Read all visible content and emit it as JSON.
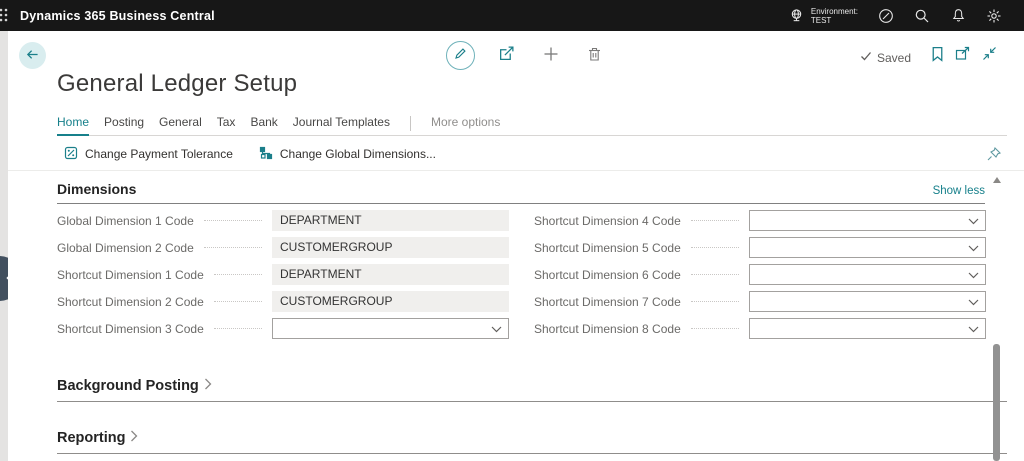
{
  "topbar": {
    "title": "Dynamics 365 Business Central",
    "environment_label": "Environment:",
    "environment_name": "TEST"
  },
  "toolbar": {
    "saved_label": "Saved"
  },
  "page": {
    "title": "General Ledger Setup"
  },
  "tabs": [
    {
      "label": "Home",
      "active": true
    },
    {
      "label": "Posting",
      "active": false
    },
    {
      "label": "General",
      "active": false
    },
    {
      "label": "Tax",
      "active": false
    },
    {
      "label": "Bank",
      "active": false
    },
    {
      "label": "Journal Templates",
      "active": false
    }
  ],
  "more_options_label": "More options",
  "actions": [
    {
      "label": "Change Payment Tolerance"
    },
    {
      "label": "Change Global Dimensions..."
    }
  ],
  "dimensions_section": {
    "title": "Dimensions",
    "show_less_label": "Show less",
    "left_fields": [
      {
        "label": "Global Dimension 1 Code",
        "value": "DEPARTMENT",
        "type": "readonly"
      },
      {
        "label": "Global Dimension 2 Code",
        "value": "CUSTOMERGROUP",
        "type": "readonly"
      },
      {
        "label": "Shortcut Dimension 1 Code",
        "value": "DEPARTMENT",
        "type": "readonly"
      },
      {
        "label": "Shortcut Dimension 2 Code",
        "value": "CUSTOMERGROUP",
        "type": "readonly"
      },
      {
        "label": "Shortcut Dimension 3 Code",
        "value": "",
        "type": "dropdown"
      }
    ],
    "right_fields": [
      {
        "label": "Shortcut Dimension 4 Code",
        "value": "",
        "type": "dropdown"
      },
      {
        "label": "Shortcut Dimension 5 Code",
        "value": "",
        "type": "dropdown"
      },
      {
        "label": "Shortcut Dimension 6 Code",
        "value": "",
        "type": "dropdown"
      },
      {
        "label": "Shortcut Dimension 7 Code",
        "value": "",
        "type": "dropdown"
      },
      {
        "label": "Shortcut Dimension 8 Code",
        "value": "",
        "type": "dropdown"
      }
    ]
  },
  "sections": [
    {
      "title": "Background Posting"
    },
    {
      "title": "Reporting"
    }
  ],
  "icons": {
    "app-launcher": "waffle-grid",
    "environment": "globe",
    "help": "circle-slash",
    "search": "magnifier",
    "notifications": "bell",
    "settings": "gear",
    "back": "arrow-left",
    "edit": "pencil",
    "share": "box-arrow-out",
    "new": "plus",
    "delete": "trash",
    "saved": "checkmark",
    "bookmark": "bookmark",
    "open-in-window": "popup",
    "collapse": "arrows-inward",
    "payment-tolerance": "percent-badge",
    "global-dimensions": "hierarchy",
    "pin": "pushpin",
    "dropdown": "chevron-down",
    "fast-tab-expand": "chevron-right",
    "nav-expand": "chevron-left"
  },
  "colors": {
    "accent_teal": "#17808b",
    "topbar_bg": "#171717",
    "readonly_field_bg": "#f0efed",
    "nav_circle": "#42505f",
    "label_gray": "#6b6a68"
  }
}
